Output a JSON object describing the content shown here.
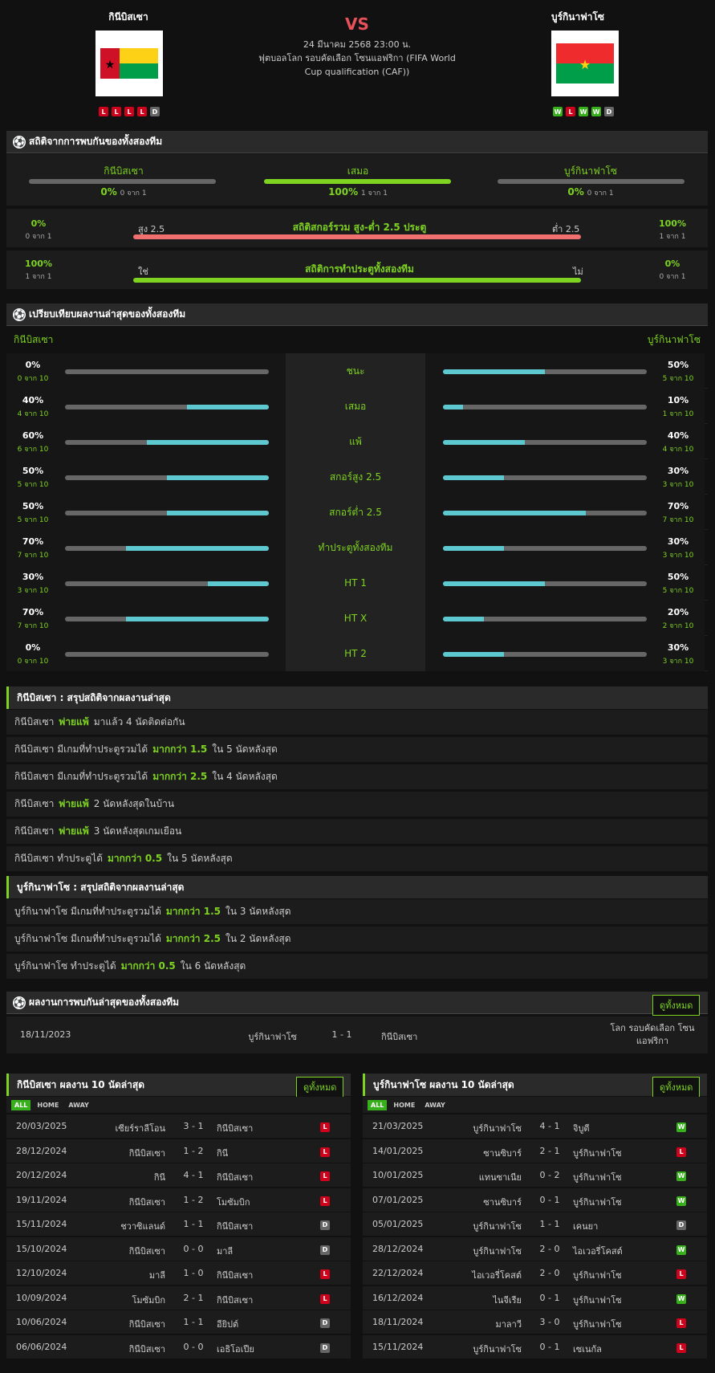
{
  "header": {
    "home_name": "กินีบิสเซา",
    "away_name": "บูร์กินาฟาโซ",
    "vs": "VS",
    "datetime": "24 มีนาคม 2568 23:00 น.",
    "competition": "ฟุตบอลโลก รอบคัดเลือก โซนแอฟริกา (FIFA World Cup qualification (CAF))",
    "home_form": [
      "L",
      "L",
      "L",
      "L",
      "D"
    ],
    "away_form": [
      "W",
      "L",
      "W",
      "W",
      "D"
    ]
  },
  "h2h": {
    "title": "สถิติจากการพบกันของทั้งสองทีม",
    "items": [
      {
        "label": "กินีบิสเซา",
        "pct": "0%",
        "sub": "0 จาก 1",
        "value": 0
      },
      {
        "label": "เสมอ",
        "pct": "100%",
        "sub": "1 จาก 1",
        "value": 100
      },
      {
        "label": "บูร์กินาฟาโซ",
        "pct": "0%",
        "sub": "0 จาก 1",
        "value": 0
      }
    ],
    "ou": {
      "left_pct": "0%",
      "left_sub": "0 จาก 1",
      "over_label": "สูง 2.5",
      "title": "สถิติสกอร์รวม สูง-ต่ำ 2.5 ประตู",
      "under_label": "ต่ำ 2.5",
      "right_pct": "100%",
      "right_sub": "1 จาก 1"
    },
    "btts": {
      "left_pct": "100%",
      "left_sub": "1 จาก 1",
      "yes_label": "ใช่",
      "title": "สถิติการทำประตูทั้งสองทีม",
      "no_label": "ไม่",
      "right_pct": "0%",
      "right_sub": "0 จาก 1"
    }
  },
  "compare": {
    "title": "เปรียบเทียบผลงานล่าสุดของทั้งสองทีม",
    "home": "กินีบิสเซา",
    "away": "บูร์กินาฟาโซ",
    "rows": [
      {
        "label": "ชนะ",
        "hp": "0%",
        "hs": "0 จาก 10",
        "hv": 0,
        "ap": "50%",
        "as": "5 จาก 10",
        "av": 50
      },
      {
        "label": "เสมอ",
        "hp": "40%",
        "hs": "4 จาก 10",
        "hv": 40,
        "ap": "10%",
        "as": "1 จาก 10",
        "av": 10
      },
      {
        "label": "แพ้",
        "hp": "60%",
        "hs": "6 จาก 10",
        "hv": 60,
        "ap": "40%",
        "as": "4 จาก 10",
        "av": 40
      },
      {
        "label": "สกอร์สูง 2.5",
        "hp": "50%",
        "hs": "5 จาก 10",
        "hv": 50,
        "ap": "30%",
        "as": "3 จาก 10",
        "av": 30
      },
      {
        "label": "สกอร์ต่ำ 2.5",
        "hp": "50%",
        "hs": "5 จาก 10",
        "hv": 50,
        "ap": "70%",
        "as": "7 จาก 10",
        "av": 70
      },
      {
        "label": "ทำประตูทั้งสองทีม",
        "hp": "70%",
        "hs": "7 จาก 10",
        "hv": 70,
        "ap": "30%",
        "as": "3 จาก 10",
        "av": 30
      },
      {
        "label": "HT 1",
        "hp": "30%",
        "hs": "3 จาก 10",
        "hv": 30,
        "ap": "50%",
        "as": "5 จาก 10",
        "av": 50
      },
      {
        "label": "HT X",
        "hp": "70%",
        "hs": "7 จาก 10",
        "hv": 70,
        "ap": "20%",
        "as": "2 จาก 10",
        "av": 20
      },
      {
        "label": "HT 2",
        "hp": "0%",
        "hs": "0 จาก 10",
        "hv": 0,
        "ap": "30%",
        "as": "3 จาก 10",
        "av": 30
      }
    ]
  },
  "home_summary": {
    "title": "กินีบิสเซา : สรุปสถิติจากผลงานล่าสุด",
    "rows": [
      [
        "กินีบิสเซา",
        "พ่ายแพ้",
        "มาแล้ว 4 นัดติดต่อกัน"
      ],
      [
        "กินีบิสเซา มีเกมที่ทำประตูรวมได้",
        "มากกว่า 1.5",
        "ใน 5 นัดหลังสุด"
      ],
      [
        "กินีบิสเซา มีเกมที่ทำประตูรวมได้",
        "มากกว่า 2.5",
        "ใน 4 นัดหลังสุด"
      ],
      [
        "กินีบิสเซา",
        "พ่ายแพ้",
        "2 นัดหลังสุดในบ้าน"
      ],
      [
        "กินีบิสเซา",
        "พ่ายแพ้",
        "3 นัดหลังสุดเกมเยือน"
      ],
      [
        "กินีบิสเซา ทำประตูได้",
        "มากกว่า 0.5",
        "ใน 5 นัดหลังสุด"
      ]
    ]
  },
  "away_summary": {
    "title": "บูร์กินาฟาโซ : สรุปสถิติจากผลงานล่าสุด",
    "rows": [
      [
        "บูร์กินาฟาโซ มีเกมที่ทำประตูรวมได้",
        "มากกว่า 1.5",
        "ใน 3 นัดหลังสุด"
      ],
      [
        "บูร์กินาฟาโซ มีเกมที่ทำประตูรวมได้",
        "มากกว่า 2.5",
        "ใน 2 นัดหลังสุด"
      ],
      [
        "บูร์กินาฟาโซ ทำประตูได้",
        "มากกว่า 0.5",
        "ใน 6 นัดหลังสุด"
      ]
    ]
  },
  "h2h_results": {
    "title": "ผลงานการพบกันล่าสุดของทั้งสองทีม",
    "view_all": "ดูทั้งหมด",
    "rows": [
      {
        "date": "18/11/2023",
        "home": "บูร์กินาฟาโซ",
        "score": "1 - 1",
        "away": "กินีบิสเซา",
        "comp": "โลก รอบคัดเลือก โซนแอฟริกา"
      }
    ]
  },
  "tabs": [
    "ALL",
    "HOME",
    "AWAY"
  ],
  "home_last": {
    "title": "กินีบิสเซา ผลงาน 10 นัดล่าสุด",
    "view_all": "ดูทั้งหมด",
    "rows": [
      [
        "20/03/2025",
        "เซียร์ราลีโอน",
        "3 - 1",
        "กินีบิสเซา",
        "L"
      ],
      [
        "28/12/2024",
        "กินีบิสเซา",
        "1 - 2",
        "กินี",
        "L"
      ],
      [
        "20/12/2024",
        "กินี",
        "4 - 1",
        "กินีบิสเซา",
        "L"
      ],
      [
        "19/11/2024",
        "กินีบิสเซา",
        "1 - 2",
        "โมซัมบิก",
        "L"
      ],
      [
        "15/11/2024",
        "ชวาซิแลนด์",
        "1 - 1",
        "กินีบิสเซา",
        "D"
      ],
      [
        "15/10/2024",
        "กินีบิสเซา",
        "0 - 0",
        "มาลี",
        "D"
      ],
      [
        "12/10/2024",
        "มาลี",
        "1 - 0",
        "กินีบิสเซา",
        "L"
      ],
      [
        "10/09/2024",
        "โมซัมบิก",
        "2 - 1",
        "กินีบิสเซา",
        "L"
      ],
      [
        "10/06/2024",
        "กินีบิสเซา",
        "1 - 1",
        "อียิปต์",
        "D"
      ],
      [
        "06/06/2024",
        "กินีบิสเซา",
        "0 - 0",
        "เอธิโอเปีย",
        "D"
      ]
    ]
  },
  "away_last": {
    "title": "บูร์กินาฟาโซ ผลงาน 10 นัดล่าสุด",
    "view_all": "ดูทั้งหมด",
    "rows": [
      [
        "21/03/2025",
        "บูร์กินาฟาโซ",
        "4 - 1",
        "จิบูตี",
        "W"
      ],
      [
        "14/01/2025",
        "ซานซิบาร์",
        "2 - 1",
        "บูร์กินาฟาโซ",
        "L"
      ],
      [
        "10/01/2025",
        "แทนซาเนีย",
        "0 - 2",
        "บูร์กินาฟาโซ",
        "W"
      ],
      [
        "07/01/2025",
        "ซานซิบาร์",
        "0 - 1",
        "บูร์กินาฟาโซ",
        "W"
      ],
      [
        "05/01/2025",
        "บูร์กินาฟาโซ",
        "1 - 1",
        "เคนยา",
        "D"
      ],
      [
        "28/12/2024",
        "บูร์กินาฟาโซ",
        "2 - 0",
        "ไอเวอรี่โคสต์",
        "W"
      ],
      [
        "22/12/2024",
        "ไอเวอรี่โคสต์",
        "2 - 0",
        "บูร์กินาฟาโซ",
        "L"
      ],
      [
        "16/12/2024",
        "ไนจีเรีย",
        "0 - 1",
        "บูร์กินาฟาโซ",
        "W"
      ],
      [
        "18/11/2024",
        "มาลาวี",
        "3 - 0",
        "บูร์กินาฟาโซ",
        "L"
      ],
      [
        "15/11/2024",
        "บูร์กินาฟาโซ",
        "0 - 1",
        "เซเนกัล",
        "L"
      ]
    ]
  }
}
